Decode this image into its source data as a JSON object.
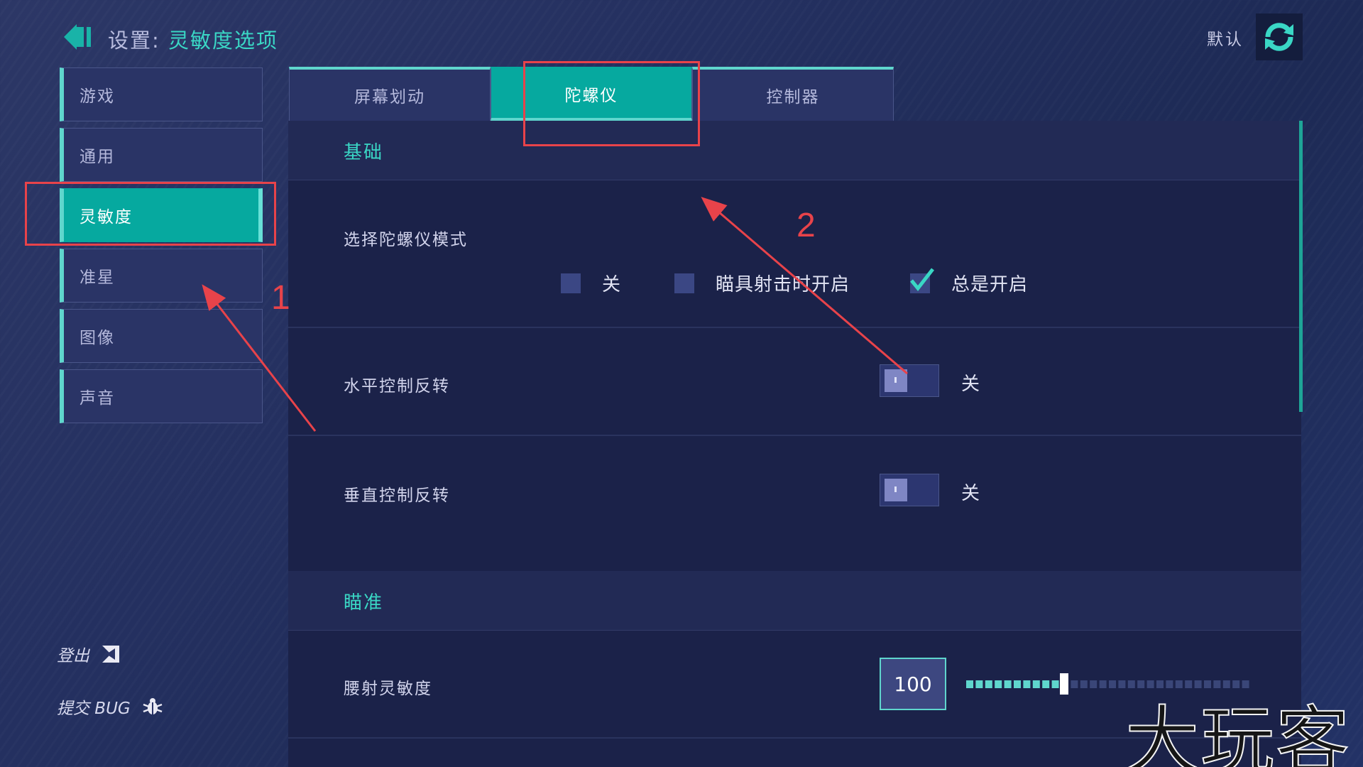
{
  "header": {
    "title_prefix": "设置:",
    "title_accent": "灵敏度选项",
    "default_label": "默认"
  },
  "sidebar": {
    "items": [
      {
        "label": "游戏"
      },
      {
        "label": "通用"
      },
      {
        "label": "灵敏度",
        "active": true
      },
      {
        "label": "准星"
      },
      {
        "label": "图像"
      },
      {
        "label": "声音"
      }
    ],
    "logout_label": "登出",
    "report_bug_label": "提交 BUG"
  },
  "tabs": [
    {
      "label": "屏幕划动"
    },
    {
      "label": "陀螺仪",
      "active": true
    },
    {
      "label": "控制器"
    }
  ],
  "sections": {
    "basic": {
      "title": "基础",
      "gyro_mode": {
        "label": "选择陀螺仪模式",
        "options": [
          {
            "label": "关",
            "checked": false
          },
          {
            "label": "瞄具射击时开启",
            "checked": false
          },
          {
            "label": "总是开启",
            "checked": true
          }
        ]
      },
      "horizontal_invert": {
        "label": "水平控制反转",
        "state": "关"
      },
      "vertical_invert": {
        "label": "垂直控制反转",
        "state": "关"
      }
    },
    "aim": {
      "title": "瞄准",
      "hip_sensitivity": {
        "label": "腰射灵敏度",
        "value": "100",
        "fill_fraction": 0.34
      }
    }
  },
  "annotations": {
    "num1": "1",
    "num2": "2"
  },
  "watermark": "大玩客",
  "colors": {
    "accent": "#06a99f",
    "accent_text": "#3ad7c5",
    "annotation": "#e8434a"
  }
}
